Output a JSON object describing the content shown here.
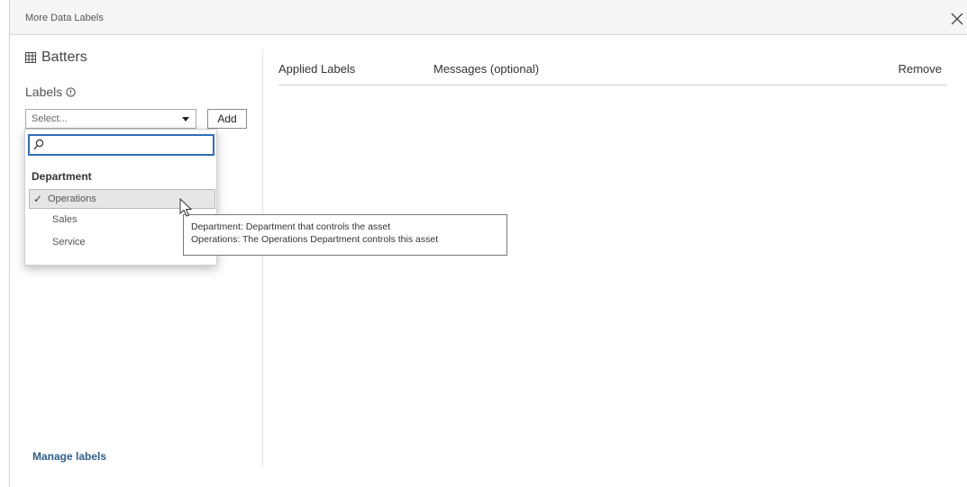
{
  "window": {
    "title": "More Data Labels",
    "close_icon": "close-icon"
  },
  "left": {
    "asset_icon": "table-icon",
    "asset_name": "Batters",
    "labels_heading": "Labels",
    "info_icon": "info-icon",
    "select": {
      "value": "Select...",
      "search_placeholder": ""
    },
    "add_label": "Add",
    "manage_link": "Manage labels"
  },
  "dropdown": {
    "group": "Department",
    "options": [
      {
        "label": "Operations",
        "checked": true
      },
      {
        "label": "Sales",
        "checked": false
      },
      {
        "label": "Service",
        "checked": false
      }
    ],
    "check_glyph": "✓"
  },
  "tooltip": {
    "line1": "Department: Department that controls the asset",
    "line2": "Operations: The Operations Department controls this asset"
  },
  "table": {
    "columns": [
      "Applied Labels",
      "Messages (optional)",
      "Remove"
    ]
  }
}
